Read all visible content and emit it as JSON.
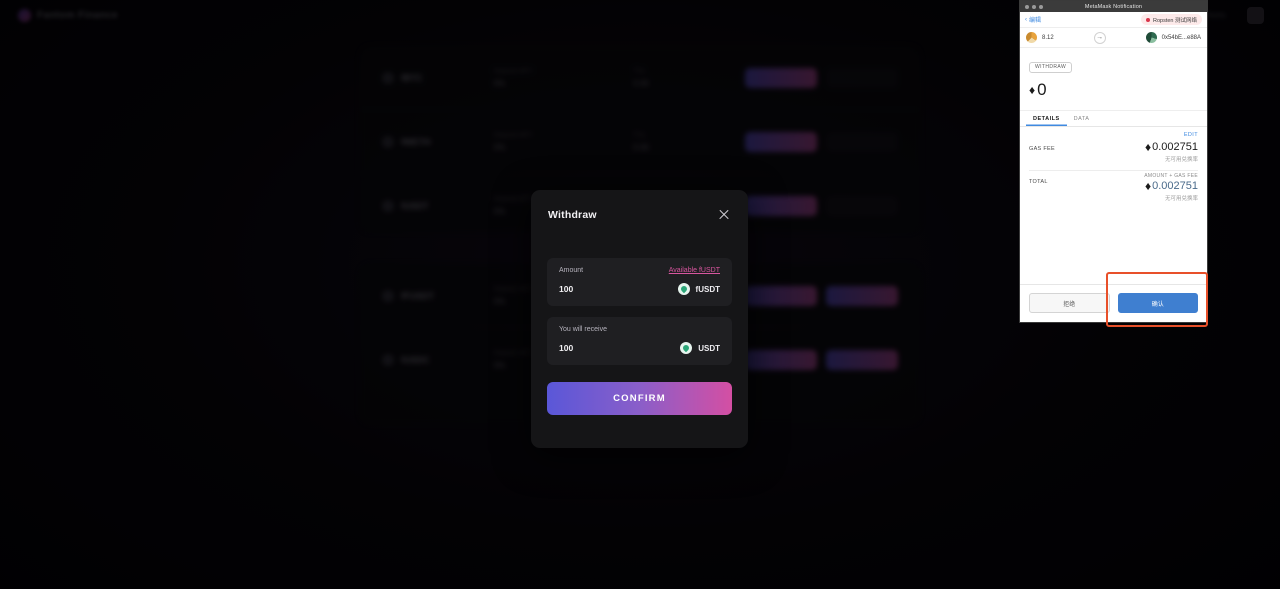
{
  "dapp": {
    "brand_name": "Fantom Finance",
    "header_link": "Markets",
    "rows": [
      {
        "symbol": "fBTC",
        "col1_label": "Deposit APY",
        "col1_value": "0%",
        "col2_label": "TVL",
        "col2_value": "0.00",
        "actions": [
          "Deposit"
        ]
      },
      {
        "symbol": "fWETH",
        "col1_label": "Deposit APY",
        "col1_value": "0%",
        "col2_label": "TVL",
        "col2_value": "0.00",
        "actions": [
          "Deposit"
        ]
      },
      {
        "symbol": "fUSDT",
        "col1_label": "Deposit APY",
        "col1_value": "0%",
        "col2_label": "TVL",
        "col2_value": "0.00",
        "actions": [
          "Deposit"
        ]
      },
      {
        "symbol": "fFUSDT",
        "col1_label": "Deposit APY",
        "col1_value": "0%",
        "col2_label": "TVL",
        "col2_value": "0.00",
        "actions": [
          "Deposit",
          "Withdraw"
        ]
      },
      {
        "symbol": "fUSDC",
        "col1_label": "Deposit APY",
        "col1_value": "0%",
        "col2_label": "TVL",
        "col2_value": "0.00",
        "actions": [
          "Deposit",
          "Withdraw"
        ]
      }
    ]
  },
  "withdraw_modal": {
    "title": "Withdraw",
    "close_label": "×",
    "amount": {
      "label": "Amount",
      "available_link": "Available fUSDT",
      "value": "100",
      "token": "fUSDT"
    },
    "receive": {
      "label": "You will receive",
      "value": "100",
      "token": "USDT"
    },
    "confirm_label": "CONFIRM"
  },
  "metamask": {
    "window_title": "MetaMask Notification",
    "back_label": "编辑",
    "network": "Ropsten 测试网络",
    "from_account": "8.12",
    "to_account": "0x54bE...e88A",
    "method_tag": "WITHDRAW",
    "amount": "0",
    "eth_symbol": "♦",
    "tabs": [
      {
        "label": "DETAILS",
        "active": true
      },
      {
        "label": "DATA",
        "active": false
      }
    ],
    "edit_label": "EDIT",
    "gas_fee": {
      "label": "GAS FEE",
      "amount": "0.002751",
      "alt": "无可用兑换率"
    },
    "total": {
      "label": "TOTAL",
      "sub_label": "AMOUNT + GAS FEE",
      "amount": "0.002751",
      "alt": "无可用兑换率"
    },
    "reject_label": "拒绝",
    "confirm_label": "确认"
  },
  "colors": {
    "accent_gradient_start": "#5a57d8",
    "accent_gradient_end": "#d44fa3",
    "metamask_blue": "#3f7fd0",
    "highlight_red": "#e8502a",
    "network_red": "#d9344a"
  }
}
